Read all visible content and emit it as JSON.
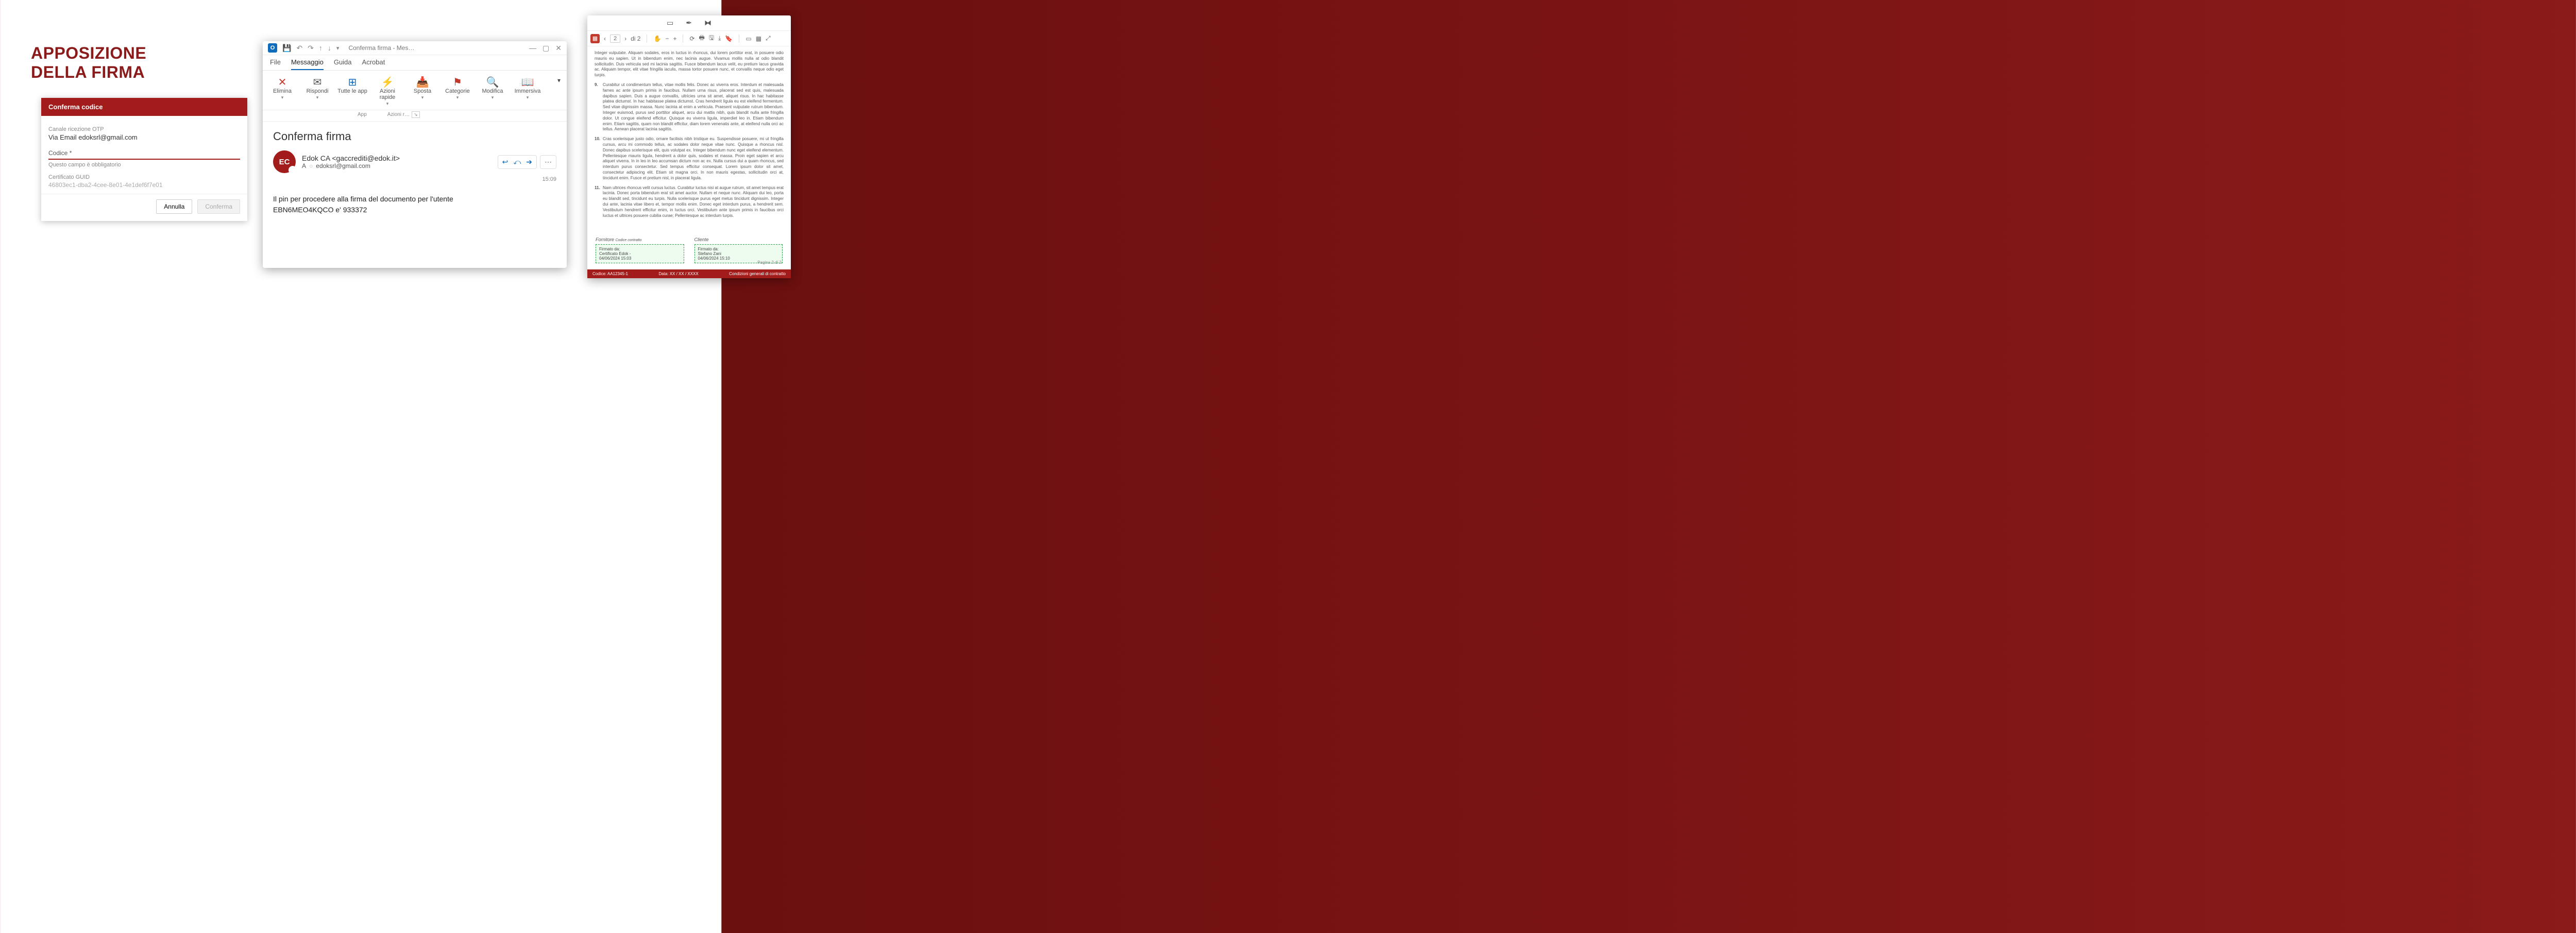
{
  "slide": {
    "title_line1": "APPOSIZIONE",
    "title_line2": "DELLA FIRMA"
  },
  "otp": {
    "header": "Conferma codice",
    "channel_label": "Canale ricezione OTP",
    "channel_value": "Via Email edoksrl@gmail.com",
    "code_label": "Codice *",
    "code_error": "Questo campo è obbligatorio",
    "guid_label": "Certificato GUID",
    "guid_value": "46803ec1-dba2-4cee-8e01-4e1def6f7e01",
    "cancel": "Annulla",
    "confirm": "Conferma"
  },
  "outlook": {
    "titlebar": "Conferma firma  -  Mes…",
    "tabs": {
      "file": "File",
      "message": "Messaggio",
      "guide": "Guida",
      "acrobat": "Acrobat"
    },
    "ribbon": {
      "delete": "Elimina",
      "reply": "Rispondi",
      "apps": "Tutte le app",
      "quick": "Azioni rapide",
      "move": "Sposta",
      "categories": "Categorie",
      "modify": "Modifica",
      "immersive": "Immersiva"
    },
    "subgroups": {
      "app": "App",
      "quick_actions": "Azioni r…"
    },
    "message": {
      "subject": "Conferma firma",
      "avatar_initials": "EC",
      "from_name": "Edok CA <gaccrediti@edok.it>",
      "to_label": "A",
      "to_value": "edoksrl@gmail.com",
      "time": "15:09",
      "body_line1": "Il pin per procedere alla firma del documento per l'utente",
      "body_line2": "EBN6MEO4KQCO e' 933372"
    }
  },
  "pdf": {
    "pager_value": "2",
    "pager_total": "di 2",
    "para_pre": "Integer vulputate. Aliquam sodales, eros in luctus in rhoncus, dui lorem porttitor erat, in posuere odio mauris eu sapien. Ut in bibendum enim, nec lacinia augue. Vivamus mollis nulla at odio blandit sollicitudin. Duis vehicula sed mi lacinia sagittis. Fusce bibendum lacus velit, eu pretium lacus gravida ac. Aliquam tempor, elit vitae fringilla iaculis, massa tortor posuere nunc, et convallis neque odio eget turpis.",
    "para9": "Curabitur ut condimentum tellus, vitae mollis felis. Donec ac viverra eros. Interdum et malesuada fames ac ante ipsum primis in faucibus. Nullam urna risus, placerat sed est quis, malesuada dapibus sapien. Duis a augue convallis, ultricies urna sit amet, aliquet risus. In hac habitasse platea dictumst. In hac habitasse platea dictumst. Cras hendrerit ligula eu est eleifend fermentum. Sed vitae dignissim massa. Nunc lacinia at enim a vehicula. Praesent vulputate rutrum bibendum. Integer euismod, purus sed porttitor aliquet, arcu dui mattis nibh, quis blandit nulla ante fringilla dolor. Ut congue eleifend efficitur. Quisque eu viverra ligula, imperdiet leo in. Etiam bibendum enim. Etiam sagittis, quam non blandit efficitur, diam lorem venenatis ante, at eleifend nulla orci ac tellus. Aenean placerat lacinia sagittis.",
    "para10": "Cras scelerisque justo odio, ornare facilisis nibh tristique eu. Suspendisse posuere, mi ut fringilla cursus, arcu mi commodo tellus, ac sodales dolor neque vitae nunc. Quisque a rhoncus nisl. Donec dapibus scelerisque elit, quis volutpat ex. Integer bibendum nunc eget eleifend elementum. Pellentesque mauris ligula, hendrerit a dolor quis, sodales et massa. Proin eget sapien et arcu aliquet viverra. In in leo in leo accumsan dictum non ac ex. Nulla cursus dui a quam rhoncus, sed interdum purus consectetur. Sed tempus efficitur consequat. Lorem ipsum dolor sit amet, consectetur adipiscing elit. Etiam sit magna orci. In non mauris egestas, sollicitudin orci at, tincidunt enim. Fusce et pretium nisl, in placerat ligula.",
    "para11": "Nam ultrices rhoncus velit cursus luctus. Curabitur luctus nisi at augue rutrum, sit amet tempus erat lacinia. Donec porta bibendum erat sit amet auctor. Nullam et neque nunc. Aliquam dui leo, porta eu blandit sed, tincidunt eu turpis. Nulla scelerisque purus eget metus tincidunt dignissim. Integer dui ante, lacinia vitae libero et, tempor mollis enim. Donec eget interdum purus, a hendrerit sem. Vestibulum hendrerit efficitur enim, in luctus orci. Vestibulum ante ipsum primis in faucibus orci luctus et ultrices posuere cubilia curae; Pellentesque ac interdum turpis.",
    "sig_left_title": "Fornitore",
    "sig_left_sub": "Codice contratto",
    "sig_left_box_l1": "Firmato da:",
    "sig_left_box_l2": "Certificato Edok -",
    "sig_left_box_l3": "04/06/2024 15:03",
    "sig_right_title": "Cliente",
    "sig_right_box_l1": "Firmato da:",
    "sig_right_box_l2": "Stefano Zani",
    "sig_right_box_l3": "04/06/2024 15:10",
    "footer_code": "Codice: AA12345-1",
    "footer_date": "Data: XX / XX / XXXX",
    "footer_right": "Condizioni generali di contratto",
    "page_num": "Pagina 2 di 2"
  }
}
